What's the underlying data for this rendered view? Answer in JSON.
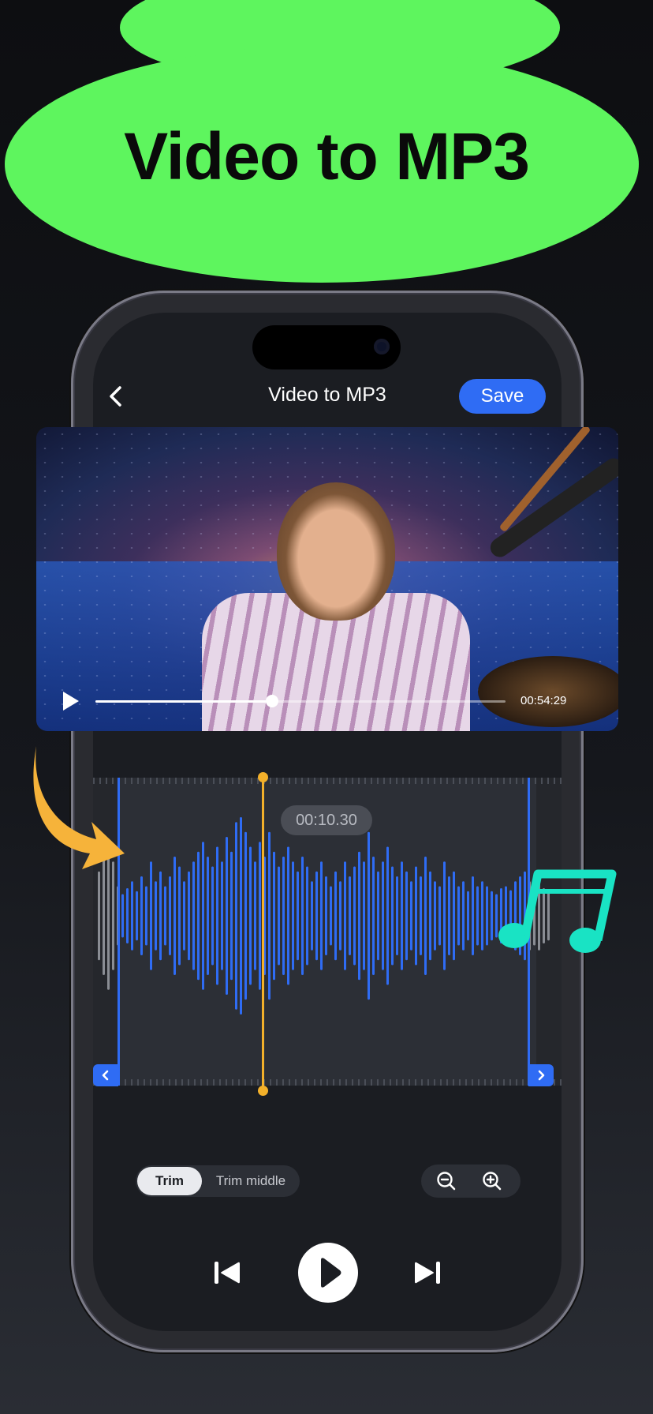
{
  "promo": {
    "headline": "Video to MP3"
  },
  "nav": {
    "title": "Video to MP3",
    "save_label": "Save"
  },
  "player": {
    "time": "00:54:29",
    "progress": 0.43
  },
  "editor": {
    "current_time": "00:10.30"
  },
  "trim_modes": {
    "options": [
      "Trim",
      "Trim middle"
    ],
    "selected": "Trim"
  },
  "colors": {
    "accent": "#2f6cf4",
    "playhead": "#f3b02a",
    "promo_green": "#5ef55e",
    "note": "#19e3c4",
    "arrow": "#f6b33a"
  },
  "icons": {
    "back": "chevron-left-icon",
    "video_play": "play-icon",
    "zoom_out": "zoom-out-icon",
    "zoom_in": "zoom-in-icon",
    "previous": "skip-back-icon",
    "play": "play-icon",
    "next": "skip-forward-icon",
    "handle_left": "chevron-left-icon",
    "handle_right": "chevron-right-icon"
  }
}
